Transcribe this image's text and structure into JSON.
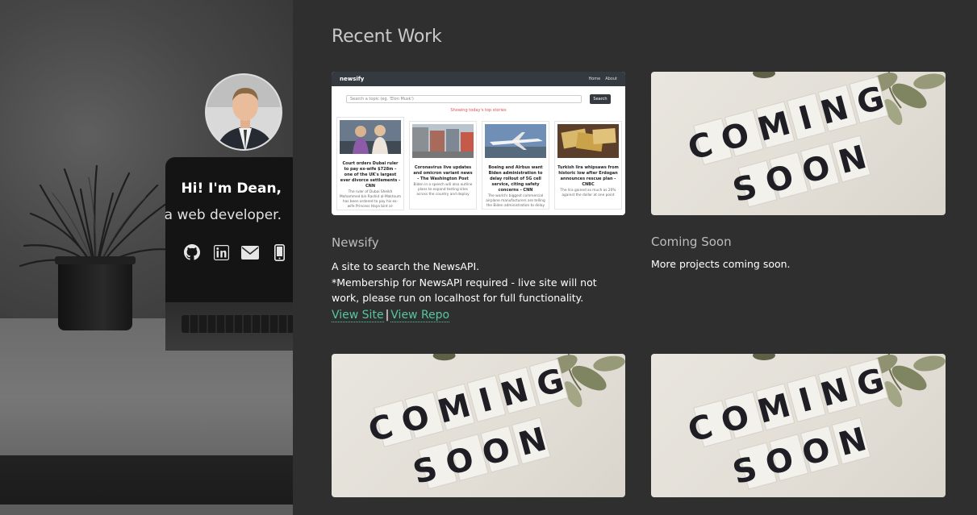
{
  "hero": {
    "greeting": "Hi! I'm Dean,",
    "role": "a web developer.",
    "socials": [
      {
        "icon": "github-icon"
      },
      {
        "icon": "linkedin-icon"
      },
      {
        "icon": "envelope-icon"
      },
      {
        "icon": "mobile-phone-icon"
      }
    ]
  },
  "main": {
    "section_title": "Recent Work",
    "projects": [
      {
        "title": "Newsify",
        "desc_line1": "A site to search the NewsAPI.",
        "desc_line2": "*Membership for NewsAPI required - live site will not work, please run on localhost for full functionality.",
        "link_site": "View Site",
        "link_sep": "|",
        "link_repo": "View Repo",
        "thumb": {
          "brand": "newsify",
          "nav_home": "Home",
          "nav_about": "About",
          "search_placeholder": "Search a topic (eg. 'Elon Musk')",
          "search_button": "Search",
          "showing": "Showing today's top stories",
          "articles": [
            {
              "title": "Court orders Dubai ruler to pay ex-wife $728m – one of the UK's largest ever divorce settlements - CNN",
              "body": "The ruler of Dubai Sheikh Mohammed bin Rashid al-Maktoum has been ordered to pay his ex-wife Princess Haya bint al-"
            },
            {
              "title": "Coronavirus live updates and omicron variant news - The Washington Post",
              "body": "Biden in a speech will also outline plans to expand testing sites across the country and deploy"
            },
            {
              "title": "Boeing and Airbus want Biden administration to delay rollout of 5G cell service, citing safety concerns - CNN",
              "body": "The world's biggest commercial airplane manufacturers are telling the Biden administration to delay"
            },
            {
              "title": "Turkish lira whipsaws from historic low after Erdogan announces rescue plan - CNBC",
              "body": "The lira gained as much as 20% against the dollar at one point"
            }
          ]
        }
      },
      {
        "title": "Coming Soon",
        "desc": "More projects coming soon.",
        "thumb_text_line1": "COMING",
        "thumb_text_line2": "SOON"
      },
      {
        "thumb_text_line1": "COMING",
        "thumb_text_line2": "SOON"
      },
      {
        "thumb_text_line1": "COMING",
        "thumb_text_line2": "SOON"
      }
    ]
  }
}
